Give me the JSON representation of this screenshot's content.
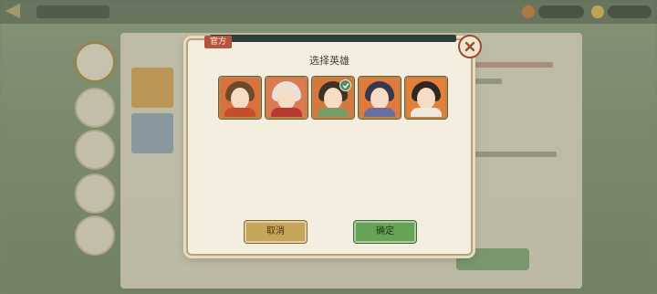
{
  "dialog": {
    "badge": "官方",
    "title": "选择英雄",
    "close_icon": "close-x-icon"
  },
  "heroes": [
    {
      "name": "hero-portrait-1",
      "selected": false,
      "bg": "#d9713f",
      "hair": "#6a4a2a",
      "robe": "#c24f2a"
    },
    {
      "name": "hero-portrait-2",
      "selected": false,
      "bg": "#dc7a55",
      "hair": "#e7e1d8",
      "robe": "#b83a2e"
    },
    {
      "name": "hero-portrait-3",
      "selected": true,
      "bg": "#d6783e",
      "hair": "#3c3323",
      "robe": "#7a9b63"
    },
    {
      "name": "hero-portrait-4",
      "selected": false,
      "bg": "#e07a3d",
      "hair": "#3a3550",
      "robe": "#6b6f9a"
    },
    {
      "name": "hero-portrait-5",
      "selected": false,
      "bg": "#e3803a",
      "hair": "#2d2824",
      "robe": "#efe8df"
    }
  ],
  "buttons": {
    "cancel": "取消",
    "confirm": "确定"
  },
  "colors": {
    "accent_red": "#b4543b",
    "confirm_green": "#66a357",
    "cancel_gold": "#c5a55a",
    "panel": "#f3eedf"
  }
}
